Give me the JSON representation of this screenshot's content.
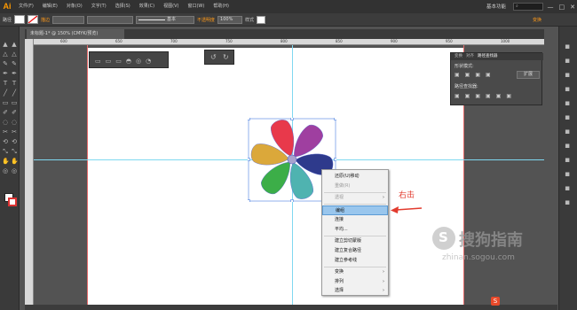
{
  "app": {
    "logo": "Ai"
  },
  "menubar": {
    "items": [
      "文件(F)",
      "编辑(E)",
      "对象(O)",
      "文字(T)",
      "选择(S)",
      "效果(C)",
      "视图(V)",
      "窗口(W)",
      "帮助(H)"
    ],
    "workspace": "基本功能",
    "window_controls": [
      "—",
      "□",
      "✕"
    ]
  },
  "controlbar": {
    "label_selection": "路径",
    "stroke_label": "描边",
    "stroke_style": "基本",
    "opacity_label": "不透明度",
    "opacity_value": "100%",
    "style_label": "样式",
    "transform_label": "变换"
  },
  "document": {
    "tab_title": "未标题-1* @ 150% (CMYK/预览)"
  },
  "ruler": {
    "ticks": [
      "600",
      "650",
      "700",
      "750",
      "800",
      "850",
      "900",
      "950",
      "1000"
    ]
  },
  "right_panel": {
    "tabs": [
      "变换",
      "对齐",
      "路径查找器"
    ],
    "shape_modes_label": "形状模式:",
    "pathfinder_label": "路径查找器:",
    "expand_button": "扩展"
  },
  "context_menu": {
    "items": [
      {
        "label": "还原(U)移动",
        "disabled": false,
        "submenu": false
      },
      {
        "label": "重做(R)",
        "disabled": true,
        "submenu": false
      },
      {
        "label": "透视",
        "disabled": true,
        "submenu": true
      },
      {
        "label": "编组",
        "disabled": false,
        "submenu": false,
        "highlighted": true
      },
      {
        "label": "连接",
        "disabled": false,
        "submenu": false
      },
      {
        "label": "平均...",
        "disabled": false,
        "submenu": false
      },
      {
        "label": "建立剪切蒙版",
        "disabled": false,
        "submenu": false
      },
      {
        "label": "建立复合路径",
        "disabled": false,
        "submenu": false
      },
      {
        "label": "建立参考线",
        "disabled": false,
        "submenu": false
      },
      {
        "label": "变换",
        "disabled": false,
        "submenu": true
      },
      {
        "label": "排列",
        "disabled": false,
        "submenu": true
      },
      {
        "label": "选择",
        "disabled": false,
        "submenu": true
      }
    ]
  },
  "annotation": {
    "text": "右击",
    "color": "#e23b2e"
  },
  "watermark": {
    "brand": "搜狗指南",
    "url": "zhinan.sogou.com"
  },
  "colors": {
    "accent_orange": "#ff9a00",
    "highlight": "#99c6ed",
    "guide": "#7fd8f0"
  },
  "petals": [
    "#e8394b",
    "#9f3fa0",
    "#2e3a8c",
    "#4fb3b0",
    "#3cae48",
    "#dba83a"
  ]
}
